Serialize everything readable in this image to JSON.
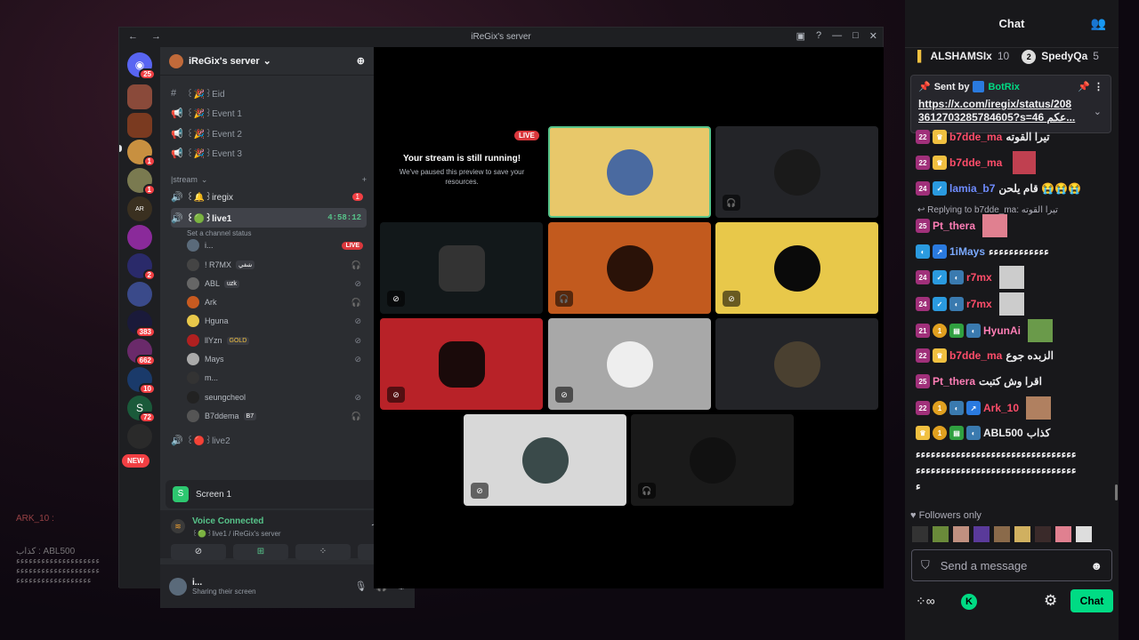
{
  "overlay_chat": {
    "line1": "ARK_10 :",
    "line2": "كذاب : ABL500",
    "line3": "ﺀﺀﺀﺀﺀﺀﺀﺀﺀﺀﺀﺀﺀﺀﺀﺀﺀﺀﺀﺀ",
    "line4": "ﺀﺀﺀﺀﺀﺀﺀﺀﺀﺀﺀﺀﺀﺀﺀﺀﺀﺀﺀﺀ",
    "line5": "ﺀﺀﺀﺀﺀﺀﺀﺀﺀﺀﺀﺀﺀﺀﺀﺀﺀﺀ"
  },
  "window": {
    "title": "iReGix's server",
    "nav": "← →"
  },
  "rail": {
    "badges": [
      "25",
      "1",
      "1",
      "2",
      "383",
      "662",
      "10",
      "72"
    ],
    "new_label": "NEW"
  },
  "sidebar": {
    "server_name": "iReGix's server",
    "channels": [
      {
        "name": "꒰🎉꒱Eid"
      },
      {
        "name": "꒰🎉꒱Event 1"
      },
      {
        "name": "꒰🎉꒱Event 2"
      },
      {
        "name": "꒰🎉꒱Event 3"
      }
    ],
    "category": "|stream",
    "voice_iregix": "꒰🔔꒱iregix",
    "iregix_badge": "1",
    "voice_live1": "꒰🟢꒱live1",
    "live1_timer": "4:58:12",
    "live1_status": "Set a channel status",
    "users": [
      {
        "name": "i...",
        "tag": "",
        "live": "LIVE"
      },
      {
        "name": "! R7MX",
        "tag": "شفي"
      },
      {
        "name": "ABL",
        "tag": "uzk"
      },
      {
        "name": "Ark",
        "tag": ""
      },
      {
        "name": "Hguna",
        "tag": ""
      },
      {
        "name": "llYzn",
        "tag": "GOLD"
      },
      {
        "name": "Mays",
        "tag": ""
      },
      {
        "name": "m...",
        "tag": ""
      },
      {
        "name": "seungcheol",
        "tag": ""
      },
      {
        "name": "B7ddema",
        "tag": "B7"
      }
    ],
    "voice_live2": "꒰🔴꒱live2",
    "screen_label": "Screen 1",
    "vc_title": "Voice Connected",
    "vc_sub": "꒰🟢꒱live1 / iReGix's server",
    "user_name": "i...",
    "user_status": "Sharing their screen"
  },
  "stage": {
    "live": "LIVE",
    "notice_title": "Your stream is still running!",
    "notice_body": "We've paused this preview to save your resources."
  },
  "chat": {
    "title": "Chat",
    "top_user1": "ALSHAMSIx",
    "top_count1": "10",
    "top_user2": "SpedyQa",
    "top_count2": "5",
    "pin_sent_by": "Sent by",
    "pin_bot": "BotRix",
    "pin_link1": "https://x.com/iregix/status/208",
    "pin_link2": "3612703285784605?s=46 عكم...",
    "messages": [
      {
        "badge": "22",
        "user": "b7dde_ma",
        "text": "تيرا القوته",
        "color": "#ff4d6a"
      },
      {
        "badge": "22",
        "user": "b7dde_ma",
        "text": "",
        "color": "#ff4d6a"
      },
      {
        "badge": "24",
        "user": "lamia_b7",
        "text": "قام يلحن 😭😭😭",
        "color": "#6f8cff"
      },
      {
        "badge": "25",
        "user": "Pt_thera",
        "text": "",
        "color": "#ff7eb6"
      },
      {
        "badge": "",
        "user": "1iMays",
        "text": "ﺀﺀﺀﺀﺀﺀﺀﺀﺀﺀﺀﺀ",
        "color": "#7aa9ff"
      },
      {
        "badge": "24",
        "user": "r7mx",
        "text": "",
        "color": "#ff4d6a"
      },
      {
        "badge": "24",
        "user": "r7mx",
        "text": "",
        "color": "#ff4d6a"
      },
      {
        "badge": "21",
        "user": "HyunAi",
        "text": "",
        "color": "#ff7eb6"
      },
      {
        "badge": "22",
        "user": "b7dde_ma",
        "text": "الزبده جوع",
        "color": "#ff4d6a"
      },
      {
        "badge": "25",
        "user": "Pt_thera",
        "text": "اقرا وش كتبت",
        "color": "#ff7eb6"
      },
      {
        "badge": "22",
        "user": "Ark_10",
        "text": "",
        "color": "#ff4d6a"
      },
      {
        "badge": "",
        "user": "ABL500",
        "text": "كذاب",
        "color": "#efeff1"
      }
    ],
    "replying": "Replying to b7dde_ma: تيرا القوته",
    "spam1": "ﺀﺀﺀﺀﺀﺀﺀﺀﺀﺀﺀﺀﺀﺀﺀﺀﺀﺀﺀﺀﺀﺀﺀﺀﺀﺀﺀﺀﺀﺀﺀﺀ",
    "spam2": "ﺀﺀﺀﺀﺀﺀﺀﺀﺀﺀﺀﺀﺀﺀﺀﺀﺀﺀﺀﺀﺀﺀﺀﺀﺀﺀﺀﺀﺀﺀﺀﺀ",
    "spam3": "ﺀ",
    "followers_only": "Followers only",
    "placeholder": "Send a message",
    "send_label": "Chat"
  }
}
